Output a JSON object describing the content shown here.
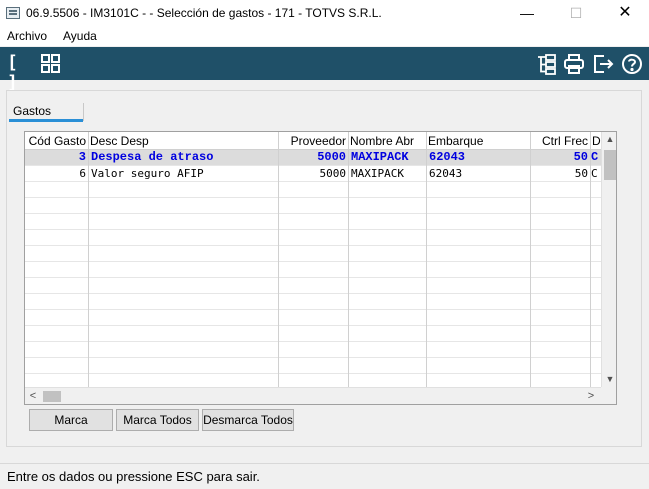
{
  "window": {
    "title": "06.9.5506 - IM3101C -  - Selección de gastos - 171 - TOTVS S.R.L.",
    "minimize_glyph": "—",
    "maximize_glyph": "☐",
    "close_glyph": "✕"
  },
  "menu": {
    "items": [
      "Archivo",
      "Ayuda"
    ]
  },
  "toolbar": {
    "left_icons": [
      "brackets-icon",
      "grid-icon"
    ],
    "right_icons": [
      "tree-icon",
      "print-icon",
      "exit-icon",
      "help-icon"
    ],
    "brackets_glyph": "[ ]",
    "accent_color": "#1f5068"
  },
  "tab": {
    "label": "Gastos",
    "accent_color": "#2a8fd6"
  },
  "table": {
    "columns": [
      "Cód Gasto",
      "Desc Desp",
      "Proveedor",
      "Nombre Abr",
      "Embarque",
      "Ctrl Frec",
      "D"
    ],
    "rows": [
      {
        "cod_gasto": "3",
        "desc_desp": "Despesa de atraso",
        "proveedor": "5000",
        "nombre_abr": "MAXIPACK",
        "embarque": "62043",
        "ctrl_frec": "50",
        "d": "C",
        "selected": true
      },
      {
        "cod_gasto": "6",
        "desc_desp": "Valor seguro AFIP",
        "proveedor": "5000",
        "nombre_abr": "MAXIPACK",
        "embarque": "62043",
        "ctrl_frec": "50",
        "d": "C",
        "selected": false
      }
    ],
    "selected_color": "#0000e0"
  },
  "buttons": {
    "marca": "Marca",
    "marca_todos": "Marca Todos",
    "desmarca_todos": "Desmarca Todos"
  },
  "status": {
    "text": "Entre os dados ou pressione ESC para sair."
  }
}
